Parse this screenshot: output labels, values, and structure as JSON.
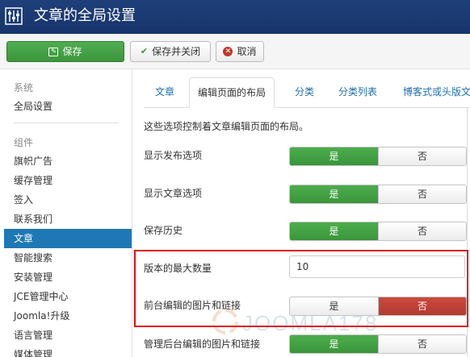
{
  "header": {
    "title": "文章的全局设置"
  },
  "toolbar": {
    "save_label": "保存",
    "save_close_label": "保存并关闭",
    "cancel_label": "取消"
  },
  "sidebar": {
    "section_system": "系统",
    "system_items": [
      "全局设置"
    ],
    "section_components": "组件",
    "items": [
      "旗帜广告",
      "缓存管理",
      "签入",
      "联系我们",
      "文章",
      "智能搜索",
      "安装管理",
      "JCE管理中心",
      "Joomla!升级",
      "语言管理",
      "媒体管理"
    ],
    "active_item": "文章"
  },
  "tabs": [
    "文章",
    "编辑页面的布局",
    "分类",
    "分类列表",
    "博客式或头版文"
  ],
  "active_tab": "编辑页面的布局",
  "form": {
    "intro": "这些选项控制着文章编辑页面的布局。",
    "rows": [
      {
        "label": "显示发布选项",
        "yes": "是",
        "no": "否",
        "selected": "yes"
      },
      {
        "label": "显示文章选项",
        "yes": "是",
        "no": "否",
        "selected": "yes"
      },
      {
        "label": "保存历史",
        "yes": "是",
        "no": "否",
        "selected": "yes"
      },
      {
        "label": "版本的最大数量",
        "value": "10"
      },
      {
        "label": "前台编辑的图片和链接",
        "yes": "是",
        "no": "否",
        "selected": "no"
      },
      {
        "label": "管理后台编辑的图片和链接",
        "yes": "是",
        "no": "否",
        "selected": "yes"
      }
    ]
  },
  "watermark": {
    "text": "JOOMLA178"
  },
  "colors": {
    "header_bg": "#1f3f7a",
    "save_green": "#46a546",
    "active_blue": "#1e78b6",
    "no_red": "#bd362f",
    "highlight_box": "#e01010"
  },
  "icons": {
    "header": "sliders-icon",
    "save": "save-icon",
    "save_close": "check-icon",
    "cancel": "cancel-circle-icon"
  }
}
